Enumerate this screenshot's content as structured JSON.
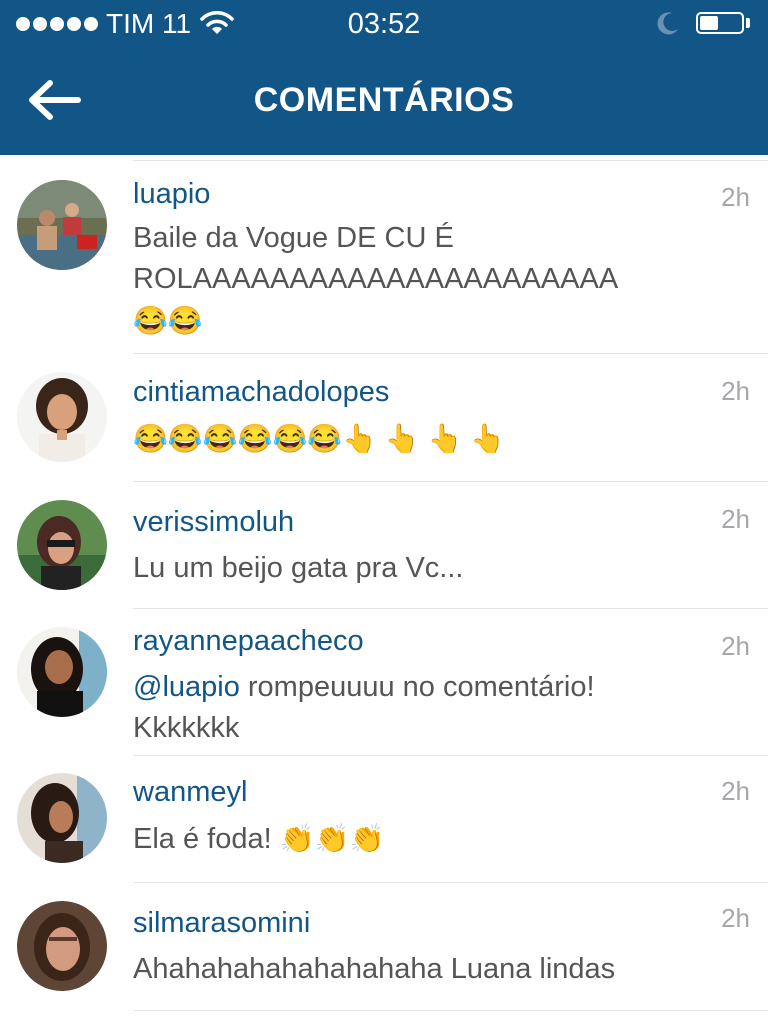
{
  "status_bar": {
    "carrier": "TIM 11",
    "time": "03:52",
    "battery_level": 0.45
  },
  "header": {
    "title": "COMENTÁRIOS",
    "back_icon": "arrow-left-icon",
    "background": "#125688"
  },
  "comments": [
    {
      "username": "luapio",
      "time": "2h",
      "text_line1": "Baile da Vogue DE CU É",
      "text_line2": "ROLAAAAAAAAAAAAAAAAAAAAAA",
      "emojis": "😂😂"
    },
    {
      "username": "cintiamachadolopes",
      "time": "2h",
      "emojis": "😂😂😂😂😂😂",
      "fingers": "👆 👆 👆 👆"
    },
    {
      "username": "verissimoluh",
      "time": "2h",
      "text": "Lu um beijo gata pra Vc..."
    },
    {
      "username": "rayannepaacheco",
      "time": "2h",
      "mention": "@luapio",
      "text_line1": " rompeuuuu no comentário!",
      "text_line2": "Kkkkkkk"
    },
    {
      "username": "wanmeyl",
      "time": "2h",
      "text": "Ela é foda! ",
      "emojis": "👏👏👏"
    },
    {
      "username": "silmarasomini",
      "time": "2h",
      "text": "Ahahahahahahahahaha Luana lindas"
    }
  ],
  "colors": {
    "link": "#125688",
    "text": "#555555",
    "timestamp": "#a5a7aa"
  }
}
